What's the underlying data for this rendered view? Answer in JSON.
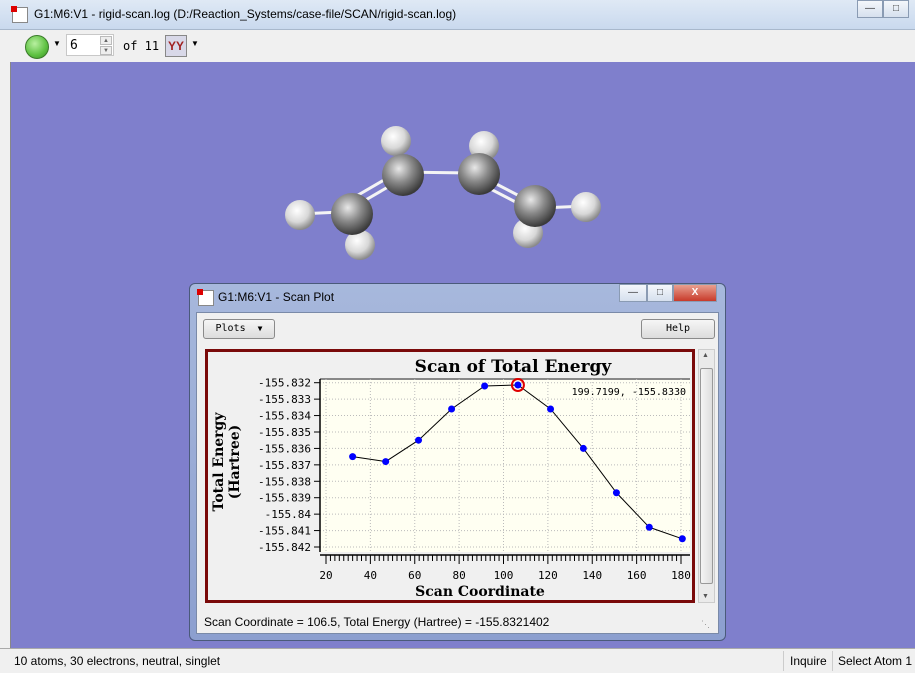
{
  "window": {
    "title": "G1:M6:V1 - rigid-scan.log (D:/Reaction_Systems/case-file/SCAN/rigid-scan.log)",
    "controls": [
      "minimize",
      "maximize",
      "close"
    ]
  },
  "toolbar": {
    "frame_value": "6",
    "of_label": "of 11",
    "icons": [
      "green-ball-icon",
      "vibration-icon"
    ]
  },
  "status_bar": {
    "info": "10 atoms, 30 electrons, neutral, singlet",
    "mode": "Inquire",
    "action": "Select Atom 1"
  },
  "scan_window": {
    "title": "G1:M6:V1 - Scan Plot",
    "plots_label": "Plots",
    "help_label": "Help",
    "status": "Scan Coordinate = 106.5, Total Energy (Hartree) = -155.8321402"
  },
  "chart_data": {
    "type": "line",
    "title": "Scan of Total Energy",
    "xlabel": "Scan Coordinate",
    "ylabel": "Total Energy (Hartree)",
    "ylabel_lines": [
      "Total Energy",
      "(Hartree)"
    ],
    "xlim": [
      20,
      180
    ],
    "ylim": [
      -155.842,
      -155.832
    ],
    "xticks": [
      "20",
      "40",
      "60",
      "80",
      "100",
      "120",
      "140",
      "160",
      "180"
    ],
    "yticks": [
      "-155.832",
      "-155.833",
      "-155.834",
      "-155.835",
      "-155.836",
      "-155.837",
      "-155.838",
      "-155.839",
      "-155.84",
      "-155.841",
      "-155.842"
    ],
    "grid": true,
    "cursor_readout": "199.7199,  -155.8330",
    "selected_index": 5,
    "x": [
      32.0,
      46.9,
      61.7,
      76.6,
      91.5,
      106.5,
      121.2,
      136.0,
      150.9,
      165.7,
      180.6
    ],
    "y": [
      -155.8365,
      -155.8368,
      -155.8355,
      -155.8336,
      -155.8322,
      -155.8321402,
      -155.8336,
      -155.836,
      -155.8387,
      -155.8408,
      -155.8415
    ],
    "colors": {
      "line": "#000000",
      "marker": "#0000ff",
      "selected": "#e00000",
      "frame": "#7a0a0a",
      "plot_bg": "#fffff2"
    }
  }
}
